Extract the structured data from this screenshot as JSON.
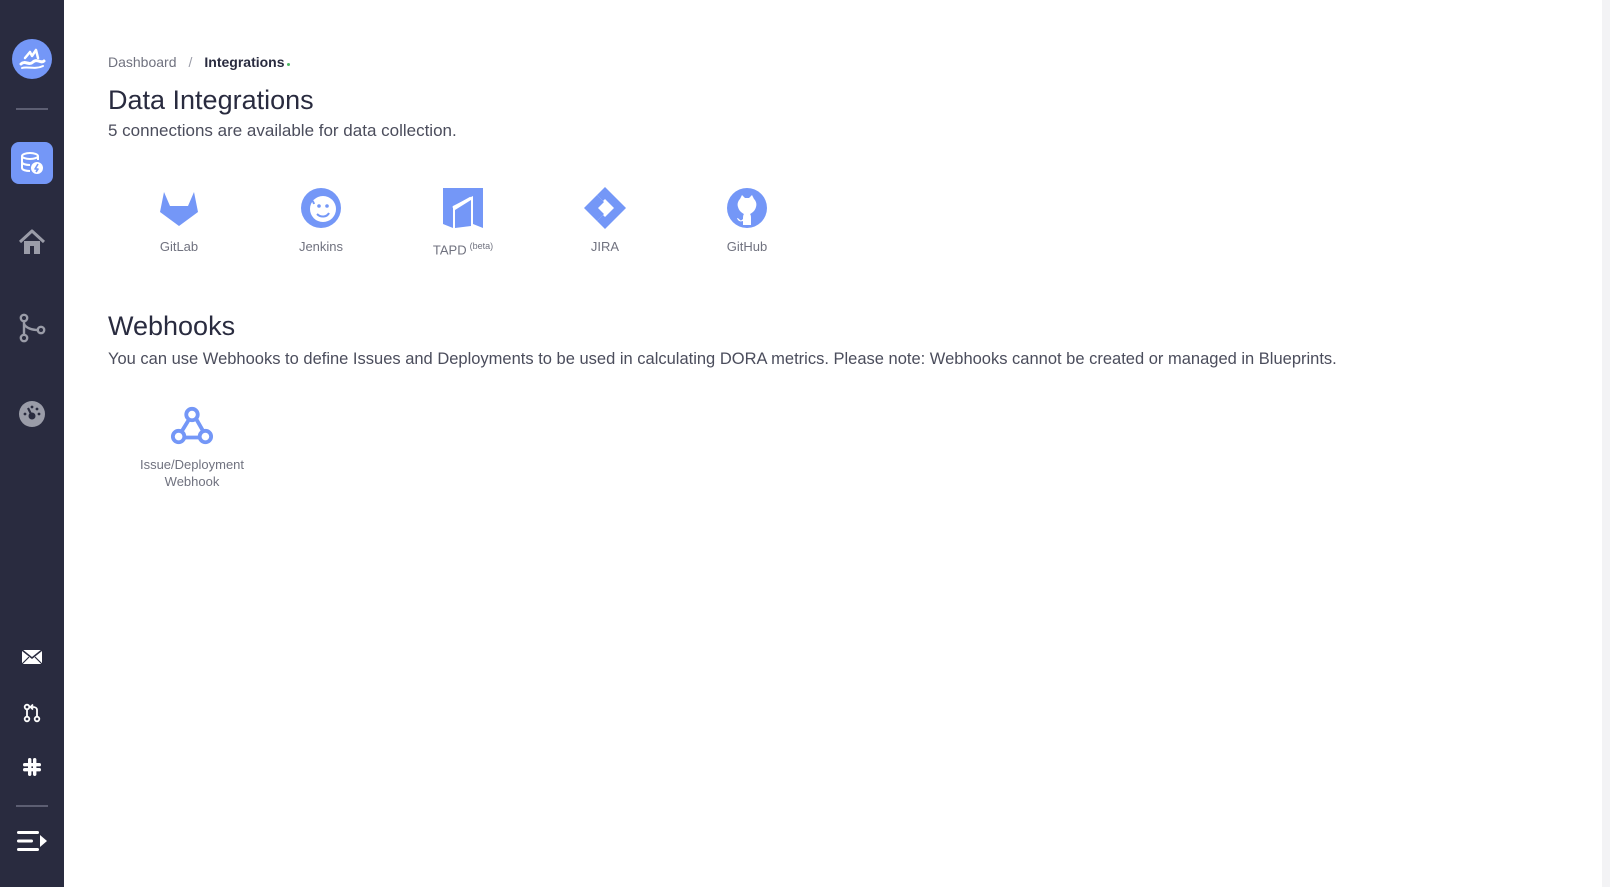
{
  "sidebar": {
    "items": [
      {
        "name": "logo",
        "icon": "devlake-logo-icon"
      },
      {
        "name": "connections",
        "icon": "database-icon",
        "active": true
      },
      {
        "name": "home",
        "icon": "home-icon"
      },
      {
        "name": "pipelines",
        "icon": "git-branch-icon"
      },
      {
        "name": "dashboards",
        "icon": "gauge-icon"
      },
      {
        "name": "email",
        "icon": "mail-icon"
      },
      {
        "name": "pull-request",
        "icon": "pull-request-icon"
      },
      {
        "name": "slack",
        "icon": "slack-icon"
      },
      {
        "name": "collapse",
        "icon": "menu-collapse-icon"
      }
    ]
  },
  "breadcrumb": {
    "home": "Dashboard",
    "separator": "/",
    "current": "Integrations"
  },
  "data_integrations": {
    "title": "Data Integrations",
    "subtitle": "5 connections are available for data collection.",
    "items": [
      {
        "label": "GitLab",
        "icon": "gitlab-icon"
      },
      {
        "label": "Jenkins",
        "icon": "jenkins-icon"
      },
      {
        "label": "TAPD",
        "badge": "(beta)",
        "icon": "tapd-icon"
      },
      {
        "label": "JIRA",
        "icon": "jira-icon"
      },
      {
        "label": "GitHub",
        "icon": "github-icon"
      }
    ]
  },
  "webhooks": {
    "title": "Webhooks",
    "description": "You can use Webhooks to define Issues and Deployments to be used in calculating DORA metrics. Please note: Webhooks cannot be created or managed in Blueprints.",
    "items": [
      {
        "label": "Issue/Deployment Webhook",
        "icon": "webhook-icon"
      }
    ]
  },
  "colors": {
    "sidebar_bg": "#292b3f",
    "accent": "#7497f7",
    "text": "#292b3f",
    "muted": "#70727f"
  }
}
